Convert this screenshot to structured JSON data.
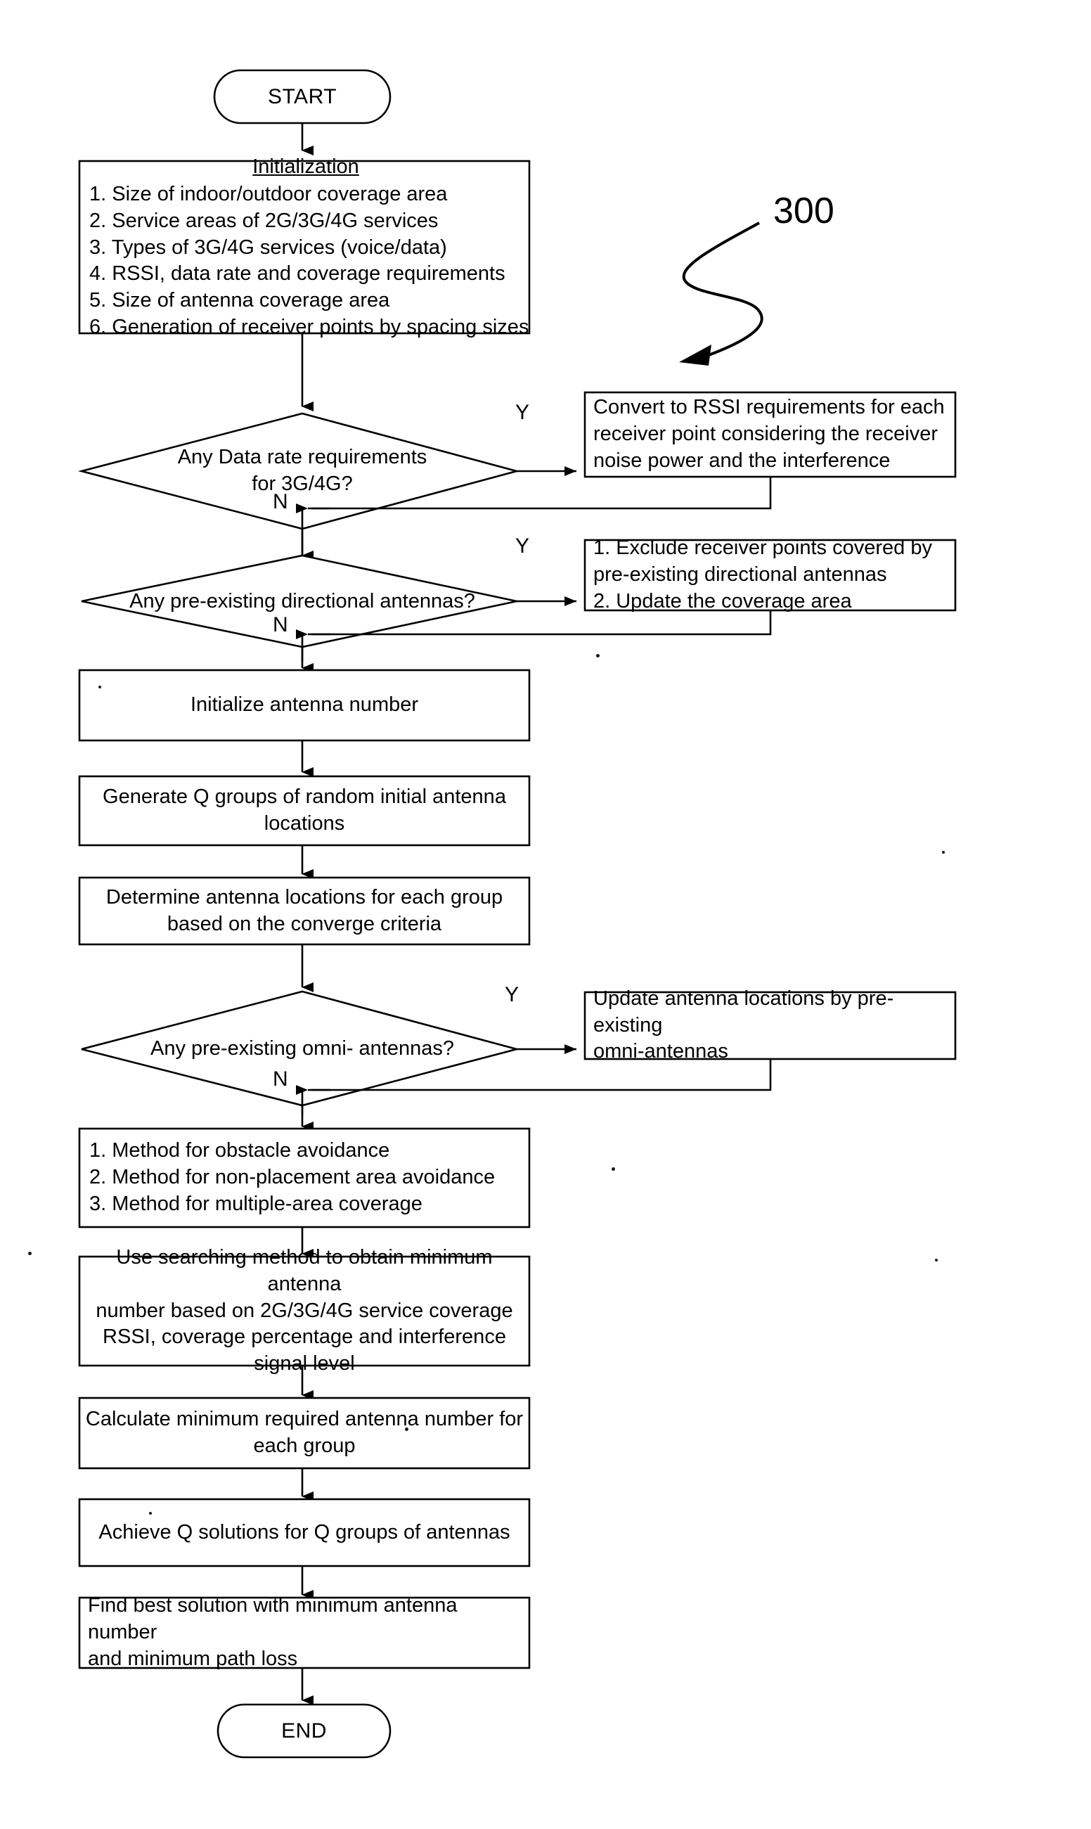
{
  "figure": {
    "number": "300",
    "leader_icon": "curly-leader-arrow-icon"
  },
  "flowchart": {
    "start": {
      "label": "START"
    },
    "end": {
      "label": "END"
    },
    "nodes": [
      {
        "id": "initialization",
        "type": "process-list",
        "title": "Initialization",
        "items": [
          "1. Size of indoor/outdoor coverage area",
          "2. Service areas of 2G/3G/4G services",
          "3. Types of 3G/4G services (voice/data)",
          "4. RSSI, data rate and coverage requirements",
          "5. Size of antenna coverage area",
          "6. Generation of receiver points by spacing sizes"
        ]
      },
      {
        "id": "decision-data-rate",
        "type": "decision",
        "lines": [
          "Any Data rate requirements",
          "for 3G/4G?"
        ],
        "yes_label": "Y",
        "no_label": "N"
      },
      {
        "id": "convert-rssi",
        "type": "process",
        "lines": [
          "Convert to RSSI requirements for each",
          "receiver point considering the receiver",
          "noise power and the interference"
        ]
      },
      {
        "id": "decision-directional",
        "type": "decision",
        "lines": [
          "Any pre-existing directional antennas?"
        ],
        "yes_label": "Y",
        "no_label": "N"
      },
      {
        "id": "exclude-points",
        "type": "process-list",
        "lines": [
          "1. Exclude receiver points covered by",
          "pre-existing directional antennas",
          "2. Update the coverage area"
        ]
      },
      {
        "id": "init-antenna-number",
        "type": "process",
        "lines": [
          "Initialize antenna number"
        ]
      },
      {
        "id": "generate-groups",
        "type": "process",
        "lines": [
          "Generate Q groups of random initial antenna",
          "locations"
        ]
      },
      {
        "id": "determine-locations",
        "type": "process",
        "lines": [
          "Determine antenna locations for each group",
          "based on the converge criteria"
        ]
      },
      {
        "id": "decision-omni",
        "type": "decision",
        "lines": [
          "Any pre-existing omni- antennas?"
        ],
        "yes_label": "Y",
        "no_label": "N"
      },
      {
        "id": "update-omni",
        "type": "process",
        "lines": [
          "Update antenna locations by pre-existing",
          "omni-antennas"
        ]
      },
      {
        "id": "methods",
        "type": "process-list",
        "lines": [
          "1. Method for obstacle avoidance",
          "2. Method for non-placement area avoidance",
          "3. Method for multiple-area coverage"
        ]
      },
      {
        "id": "searching-method",
        "type": "process",
        "lines": [
          "Use searching method to obtain minimum antenna",
          "number based on 2G/3G/4G service coverage",
          "RSSI, coverage percentage and interference",
          "signal level"
        ]
      },
      {
        "id": "calculate-minimum",
        "type": "process",
        "lines": [
          "Calculate minimum required antenna number for",
          "each group"
        ]
      },
      {
        "id": "achieve-solutions",
        "type": "process",
        "lines": [
          "Achieve Q solutions for Q groups of antennas"
        ]
      },
      {
        "id": "find-best",
        "type": "process",
        "lines": [
          "Find best solution with minimum antenna number",
          "and minimum path loss"
        ]
      }
    ]
  },
  "style": {
    "stroke": "#000000",
    "fill": "#ffffff",
    "background": "#ffffff"
  }
}
